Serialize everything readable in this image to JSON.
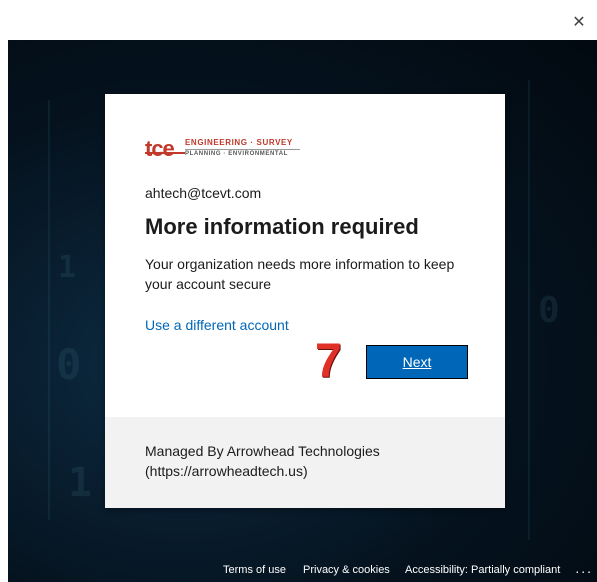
{
  "window": {
    "close_icon": "close-icon"
  },
  "card": {
    "logo": {
      "mark": "tce",
      "line1": "ENGINEERING · SURVEY",
      "line2": "PLANNING · ENVIRONMENTAL"
    },
    "email": "ahtech@tcevt.com",
    "title": "More information required",
    "description": "Your organization needs more information to keep your account secure",
    "different_account_link": "Use a different account",
    "next_label": "Next",
    "annotation_step": "7",
    "managed_by": "Managed By Arrowhead Technologies (https://arrowheadtech.us)"
  },
  "footer": {
    "terms": "Terms of use",
    "privacy": "Privacy & cookies",
    "accessibility": "Accessibility: Partially compliant",
    "more": "..."
  },
  "colors": {
    "accent": "#0067b8",
    "annotation": "#e03028",
    "brand": "#c0392b"
  }
}
